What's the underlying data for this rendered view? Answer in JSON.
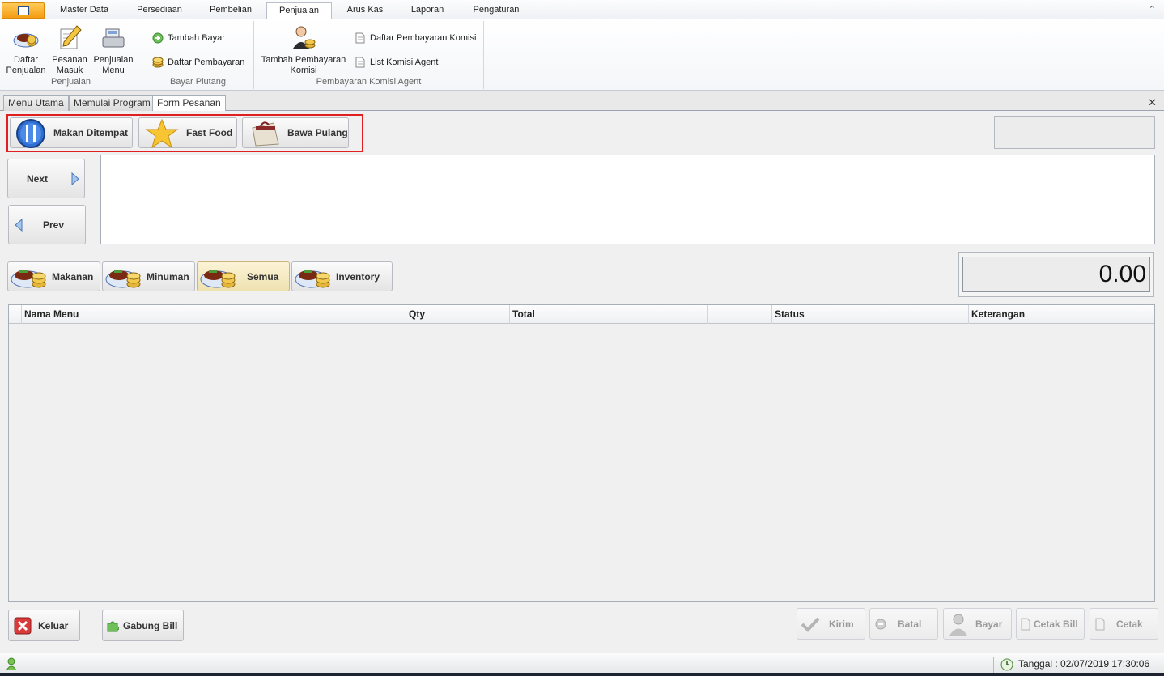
{
  "menu": {
    "tabs": [
      "Master Data",
      "Persediaan",
      "Pembelian",
      "Penjualan",
      "Arus Kas",
      "Laporan",
      "Pengaturan"
    ],
    "active_tab": "Penjualan"
  },
  "ribbon": {
    "groups": {
      "penjualan": {
        "label": "Penjualan",
        "buttons": [
          "Daftar\nPenjualan",
          "Pesanan\nMasuk",
          "Penjualan\nMenu"
        ]
      },
      "bayar_piutang": {
        "label": "Bayar Piutang",
        "buttons": [
          "Tambah Bayar",
          "Daftar Pembayaran"
        ]
      },
      "komisi": {
        "label": "Pembayaran Komisi Agent",
        "big_button": "Tambah Pembayaran\nKomisi",
        "buttons": [
          "Daftar Pembayaran Komisi",
          "List Komisi Agent"
        ]
      }
    }
  },
  "doc_tabs": [
    "Menu Utama",
    "Memulai Program",
    "Form Pesanan"
  ],
  "active_doc_tab": "Form Pesanan",
  "order_type_buttons": [
    "Makan Ditempat",
    "Fast Food",
    "Bawa Pulang"
  ],
  "nav": {
    "next": "Next",
    "prev": "Prev"
  },
  "category_buttons": [
    "Makanan",
    "Minuman",
    "Semua",
    "Inventory"
  ],
  "active_category": "Semua",
  "total": "0.00",
  "grid": {
    "columns": [
      "Nama Menu",
      "Qty",
      "Total",
      "",
      "Status",
      "Keterangan"
    ]
  },
  "footer": {
    "left": [
      "Keluar",
      "Gabung Bill"
    ],
    "right": [
      "Kirim",
      "Batal",
      "Bayar",
      "Cetak Bill",
      "Cetak"
    ]
  },
  "status": {
    "datetime": "Tanggal : 02/07/2019 17:30:06"
  },
  "colors": {
    "highlight": "#e02020",
    "app_button": "#f39c12"
  }
}
